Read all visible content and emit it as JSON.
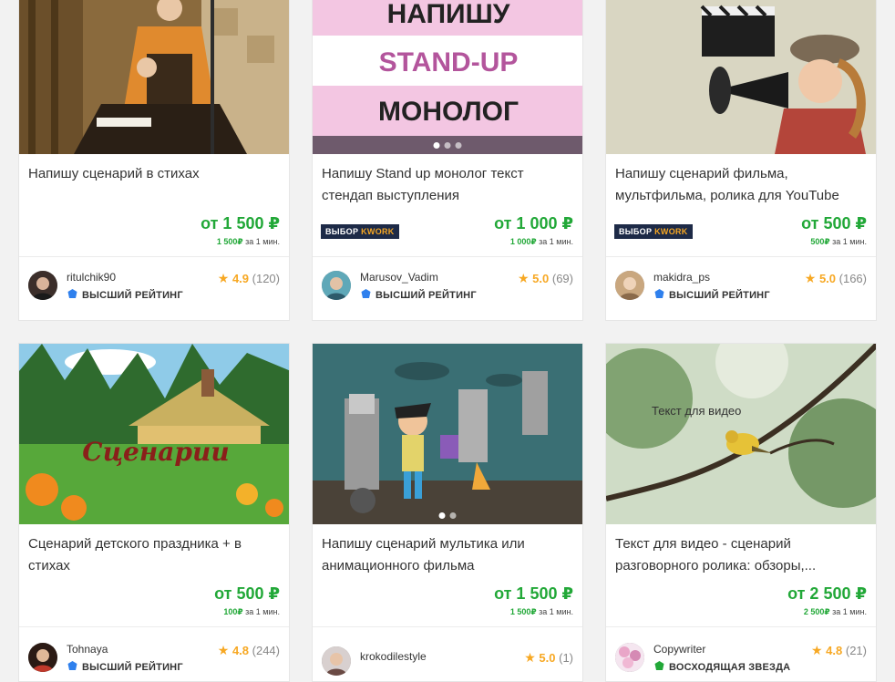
{
  "cards": [
    {
      "title": "Напишу сценарий в стихах",
      "badge": false,
      "price": "от 1 500 ₽",
      "price_sub_amount": "1 500₽",
      "price_sub_text": "за 1 мин.",
      "seller": "ritulchik90",
      "level": "ВЫСШИЙ РЕЙТИНГ",
      "rating": "4.9",
      "reviews": "(120)"
    },
    {
      "title": "Напишу Stand up монолог текст стендап выступления",
      "badge": true,
      "thumb_lines": [
        "НАПИШУ",
        "STAND-UP",
        "МОНОЛОГ"
      ],
      "price": "от 1 000 ₽",
      "price_sub_amount": "1 000₽",
      "price_sub_text": "за 1 мин.",
      "seller": "Marusov_Vadim",
      "level": "ВЫСШИЙ РЕЙТИНГ",
      "rating": "5.0",
      "reviews": "(69)"
    },
    {
      "title": "Напишу сценарий фильма, мультфильма, ролика для YouTube",
      "badge": true,
      "price": "от 500 ₽",
      "price_sub_amount": "500₽",
      "price_sub_text": "за 1 мин.",
      "seller": "makidra_ps",
      "level": "ВЫСШИЙ РЕЙТИНГ",
      "rating": "5.0",
      "reviews": "(166)"
    },
    {
      "title": "Сценарий детского праздника + в стихах",
      "badge": false,
      "thumb_text": "Сценарии",
      "price": "от 500 ₽",
      "price_sub_amount": "100₽",
      "price_sub_text": "за 1 мин.",
      "seller": "Tohnaya",
      "level": "ВЫСШИЙ РЕЙТИНГ",
      "rating": "4.8",
      "reviews": "(244)"
    },
    {
      "title": "Напишу сценарий мультика или анимационного фильма",
      "badge": false,
      "price": "от 1 500 ₽",
      "price_sub_amount": "1 500₽",
      "price_sub_text": "за 1 мин.",
      "seller": "krokodilestyle",
      "level": "",
      "rating": "5.0",
      "reviews": "(1)"
    },
    {
      "title": "Текст для видео - сценарий разговорного ролика: обзоры,...",
      "badge": false,
      "thumb_text": "Текст для видео",
      "price": "от 2 500 ₽",
      "price_sub_amount": "2 500₽",
      "price_sub_text": "за 1 мин.",
      "seller": "Copywriter",
      "level": "ВОСХОДЯЩАЯ ЗВЕЗДА",
      "rating": "4.8",
      "reviews": "(21)"
    }
  ],
  "badge_label": {
    "prefix": "ВЫБОР",
    "brand": "KWORK"
  },
  "icons": {
    "star": "star-icon",
    "level": "badge-icon"
  },
  "colors": {
    "price": "#22a838",
    "star": "#f7a823",
    "badge_bg": "#1d2a47",
    "level_icon_blue": "#2f80ed",
    "level_icon_green": "#22a838"
  }
}
